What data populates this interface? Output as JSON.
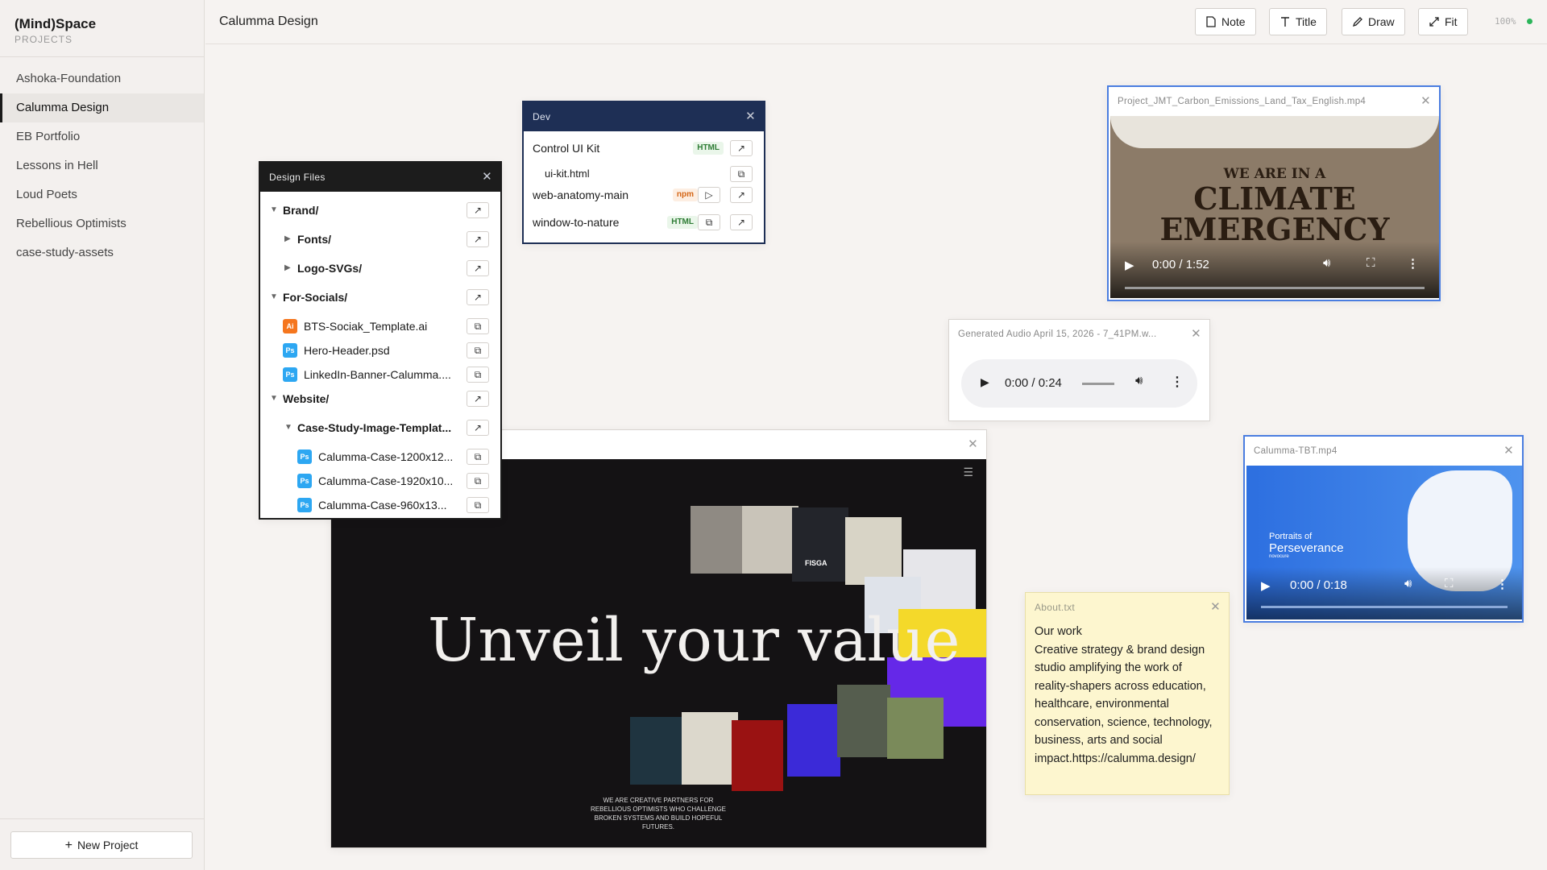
{
  "sidebar": {
    "brand": "(Mind)Space",
    "subtitle": "PROJECTS",
    "projects": [
      "Ashoka-Foundation",
      "Calumma Design",
      "EB Portfolio",
      "Lessons in Hell",
      "Loud Poets",
      "Rebellious Optimists",
      "case-study-assets"
    ],
    "active_project": "Calumma Design",
    "new_project": "New Project"
  },
  "topbar": {
    "title": "Calumma Design",
    "buttons": {
      "note": "Note",
      "title": "Title",
      "draw": "Draw",
      "fit": "Fit"
    },
    "zoom": "100%"
  },
  "design_files": {
    "title": "Design Files",
    "items": [
      {
        "label": "Brand/",
        "kind": "folder",
        "expanded": true
      },
      {
        "label": "Fonts/",
        "kind": "folder",
        "expanded": false
      },
      {
        "label": "Logo-SVGs/",
        "kind": "folder",
        "expanded": false
      },
      {
        "label": "For-Socials/",
        "kind": "folder",
        "expanded": true
      },
      {
        "label": "BTS-Sociak_Template.ai",
        "kind": "ai",
        "icon": "Ai"
      },
      {
        "label": "Hero-Header.psd",
        "kind": "ps",
        "icon": "Ps"
      },
      {
        "label": "LinkedIn-Banner-Calumma....",
        "kind": "ps",
        "icon": "Ps"
      },
      {
        "label": "Website/",
        "kind": "folder",
        "expanded": true
      },
      {
        "label": "Case-Study-Image-Templat...",
        "kind": "folder",
        "expanded": true
      },
      {
        "label": "Calumma-Case-1200x12...",
        "kind": "ps",
        "icon": "Ps"
      },
      {
        "label": "Calumma-Case-1920x10...",
        "kind": "ps",
        "icon": "Ps"
      },
      {
        "label": "Calumma-Case-960x13...",
        "kind": "ps",
        "icon": "Ps"
      }
    ]
  },
  "dev": {
    "title": "Dev",
    "items": [
      {
        "label": "Control UI Kit",
        "badge": "HTML"
      },
      {
        "label": "ui-kit.html",
        "badge": ""
      },
      {
        "label": "web-anatomy-main",
        "badge": "npm"
      },
      {
        "label": "window-to-nature",
        "badge": "HTML"
      }
    ]
  },
  "video1": {
    "title": "Project_JMT_Carbon_Emissions_Land_Tax_English.mp4",
    "line1": "WE ARE IN A",
    "line2": "CLIMATE",
    "line3": "EMERGENCY",
    "time": "0:00 / 1:52"
  },
  "audio": {
    "title": "Generated Audio April 15, 2026 - 7_41PM.w...",
    "time": "0:00 / 0:24"
  },
  "video2": {
    "title": "Calumma-TBT.mp4",
    "brand_small": "Portraits of",
    "brand_big": "Perseverance",
    "brand_tiny": "novocure",
    "time": "0:00 / 0:18"
  },
  "website": {
    "headline": "Unveil your value",
    "tagline": "WE ARE CREATIVE PARTNERS FOR REBELLIOUS OPTIMISTS WHO CHALLENGE BROKEN SYSTEMS AND BUILD HOPEFUL FUTURES.",
    "tile_label": "FISGA"
  },
  "about": {
    "title": "About.txt",
    "body": "Our work\nCreative strategy & brand design studio amplifying the work of reality-shapers across education, healthcare, environmental conservation, science, technology, business, arts and social impact.https://calumma.design/"
  },
  "colors": {
    "navy": "#1e2f55",
    "accent_green": "#2bb55a",
    "note_bg": "#fdf6cf"
  }
}
